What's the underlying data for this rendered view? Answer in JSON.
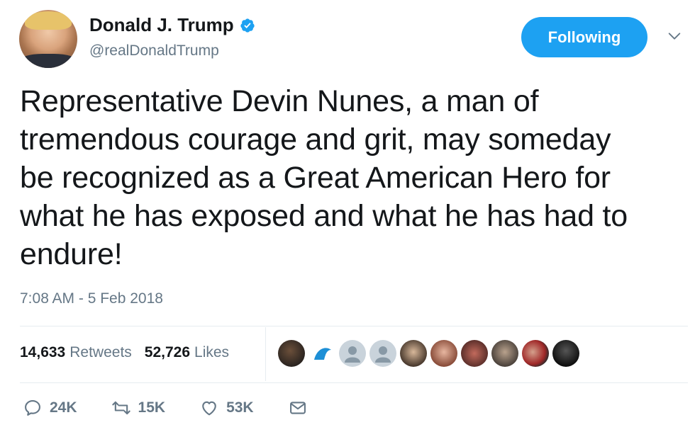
{
  "author": {
    "name": "Donald J. Trump",
    "handle": "@realDonaldTrump",
    "verified_icon": "verified-badge-icon"
  },
  "follow_button": {
    "label": "Following"
  },
  "tweet": {
    "text": "Representative Devin Nunes, a man of\ntremendous courage and grit, may someday\nbe recognized as a Great American Hero for\nwhat he has exposed and what he has had to\nendure!",
    "timestamp": "7:08 AM - 5 Feb 2018"
  },
  "stats": {
    "retweets_count": "14,633",
    "retweets_label": "Retweets",
    "likes_count": "52,726",
    "likes_label": "Likes"
  },
  "actions": {
    "reply_count": "24K",
    "retweet_count": "15K",
    "like_count": "53K"
  },
  "colors": {
    "accent": "#1da1f2",
    "secondary_text": "#657786",
    "primary_text": "#14171a"
  }
}
